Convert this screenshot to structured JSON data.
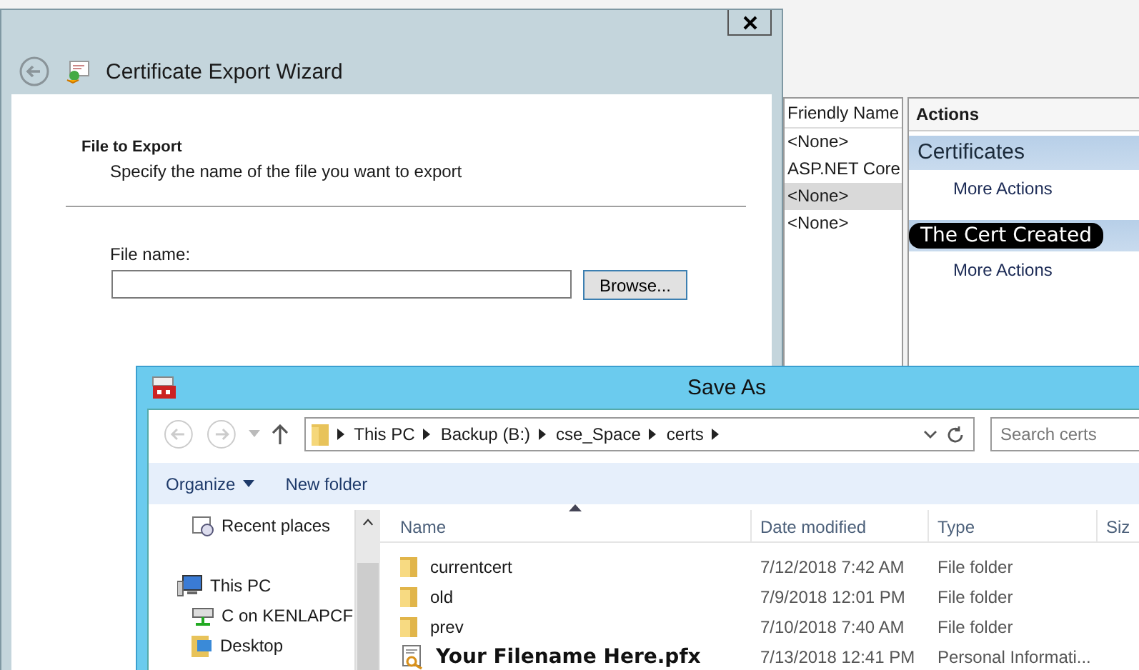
{
  "console": {
    "list_column": "Friendly Name",
    "list_rows": [
      {
        "text": "<None>",
        "selected": false
      },
      {
        "text": "ASP.NET Core",
        "selected": false
      },
      {
        "text": "<None>",
        "selected": true
      },
      {
        "text": "<None>",
        "selected": false
      }
    ],
    "actions": {
      "title": "Actions",
      "groups": [
        {
          "header": "Certificates",
          "kind": "plain",
          "items": [
            "More Actions"
          ]
        },
        {
          "header": "The Cert Created",
          "kind": "scribbled",
          "items": [
            "More Actions"
          ]
        }
      ]
    }
  },
  "wizard": {
    "title": "Certificate Export Wizard",
    "section_title": "File to Export",
    "section_subtitle": "Specify the name of the file you want to export",
    "file_name_label": "File name:",
    "browse_button": "Browse..."
  },
  "save_as": {
    "title": "Save As",
    "breadcrumb": [
      "This PC",
      "Backup (B:)",
      "cse_Space",
      "certs"
    ],
    "search": {
      "placeholder": "Search certs"
    },
    "toolbar": [
      {
        "label": "Organize",
        "kind": "menu"
      },
      {
        "label": "New folder",
        "kind": "plain"
      }
    ],
    "nav": [
      {
        "label": "Recent places",
        "kind": "recent"
      },
      {
        "label": "This PC",
        "kind": "pc",
        "children": [
          {
            "label": "C on KENLAPCF",
            "kind": "drive"
          },
          {
            "label": "Desktop",
            "kind": "folder"
          }
        ]
      }
    ],
    "columns": [
      "Name",
      "Date modified",
      "Type",
      "Siz"
    ],
    "files": [
      {
        "name": "currentcert",
        "date": "7/12/2018 7:42 AM",
        "type": "File folder",
        "kind": "folder"
      },
      {
        "name": "old",
        "date": "7/9/2018 12:01 PM",
        "type": "File folder",
        "kind": "folder"
      },
      {
        "name": "prev",
        "date": "7/10/2018 7:40 AM",
        "type": "File folder",
        "kind": "folder"
      },
      {
        "name": "Your Filename Here.pfx",
        "date": "7/13/2018 12:41 PM",
        "type": "Personal Informati...",
        "kind": "certificate"
      }
    ]
  }
}
